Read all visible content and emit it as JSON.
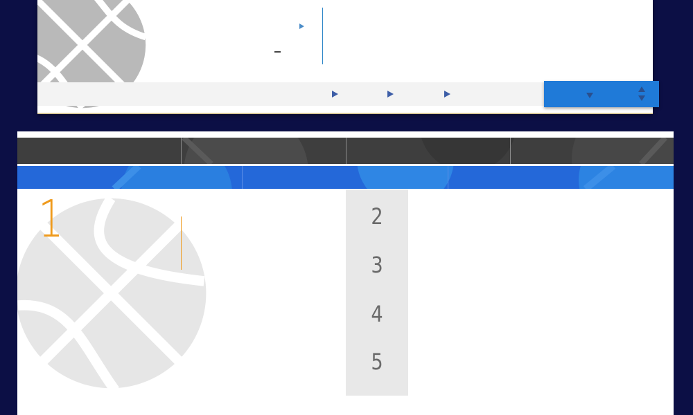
{
  "top_card": {
    "nav_items": [
      {
        "icon": "play-triangle-icon"
      },
      {
        "icon": "play-triangle-icon"
      },
      {
        "icon": "play-triangle-icon"
      }
    ],
    "select": {
      "caret_icon": "caret-down-icon",
      "spinner_icon": "sort-spinner-icon"
    }
  },
  "main": {
    "tab_count": 4,
    "blue_tab_count": 3,
    "featured_rank": "1",
    "ranks": [
      "2",
      "3",
      "4",
      "5"
    ]
  },
  "colors": {
    "background": "#0c0f45",
    "accent_blue": "#1f7ad8",
    "tab_dark": "#3e3e3e",
    "rank_orange": "#ef9a1c",
    "ball_gray": "#b9b9b9"
  }
}
